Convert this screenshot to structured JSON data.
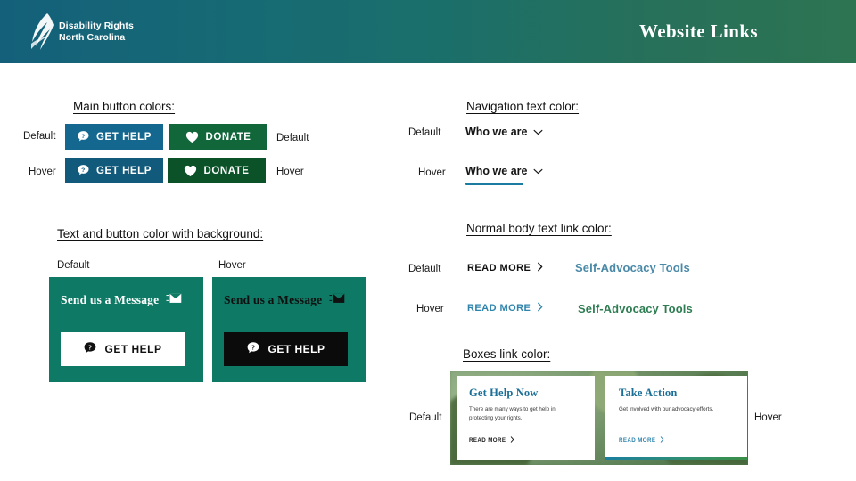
{
  "header": {
    "title": "Website Links",
    "logo_line1": "Disability Rights",
    "logo_line2": "North Carolina",
    "logo_icon": "feather-logo-icon",
    "gradient_from": "#14607a",
    "gradient_to": "#2d7452"
  },
  "sections": {
    "main_buttons": {
      "heading": "Main button colors:"
    },
    "bg_panels": {
      "heading": "Text and button color with background:"
    },
    "navigation": {
      "heading": "Navigation text color:"
    },
    "body_links": {
      "heading": "Normal body text link color:"
    },
    "boxes": {
      "heading": "Boxes link color:"
    }
  },
  "labels": {
    "default": "Default",
    "hover": "Hover"
  },
  "main_buttons": {
    "get_help": {
      "label": "GET HELP",
      "icon": "question-bubble-icon",
      "default_bg": "#14688f",
      "hover_bg": "#115a7c",
      "text_color": "#ffffff"
    },
    "donate": {
      "label": "DONATE",
      "icon": "heart-icon",
      "default_bg": "#11663a",
      "hover_bg": "#0c5229",
      "text_color": "#ffffff"
    }
  },
  "bg_panels": {
    "default": {
      "state_label": "Default",
      "panel_bg": "#0e7a65",
      "message_text": "Send us a Message",
      "message_color": "#ffffff",
      "message_icon": "envelope-icon",
      "button_label": "GET HELP",
      "button_icon": "question-bubble-icon",
      "button_bg": "#ffffff",
      "button_text_color": "#111111"
    },
    "hover": {
      "state_label": "Hover",
      "panel_bg": "#0e7a65",
      "message_text": "Send us a Message",
      "message_color": "#101010",
      "message_icon": "envelope-icon",
      "button_label": "GET HELP",
      "button_icon": "question-bubble-icon",
      "button_bg": "#0b0b0b",
      "button_text_color": "#ffffff"
    }
  },
  "navigation": {
    "default": {
      "state_label": "Default",
      "text": "Who we are",
      "icon": "chevron-down-icon",
      "color": "#151515"
    },
    "hover": {
      "state_label": "Hover",
      "text": "Who we are",
      "icon": "chevron-down-icon",
      "color": "#151515",
      "underline_color": "#1b7ba0"
    }
  },
  "body_links": {
    "default": {
      "state_label": "Default",
      "read_more": "READ MORE",
      "read_more_icon": "chevron-right-icon",
      "read_more_color": "#111111",
      "text_link": "Self-Advocacy Tools",
      "text_link_color": "#4a89a8"
    },
    "hover": {
      "state_label": "Hover",
      "read_more": "READ MORE",
      "read_more_icon": "chevron-right-icon",
      "read_more_color": "#2f84ad",
      "text_link": "Self-Advocacy Tools",
      "text_link_color": "#2e7d52"
    }
  },
  "boxes": {
    "default_label": "Default",
    "hover_label": "Hover",
    "cards": [
      {
        "title": "Get Help Now",
        "title_color": "#1b6f96",
        "body": "There are many ways to get help in protecting your rights.",
        "link": "READ MORE",
        "link_icon": "chevron-right-icon",
        "link_color": "#1a1a1a",
        "accent": false
      },
      {
        "title": "Take Action",
        "title_color": "#1b6f96",
        "body": "Get involved with our advocacy efforts.",
        "link": "READ MORE",
        "link_icon": "chevron-right-icon",
        "link_color": "#2f84ad",
        "accent": true,
        "accent_gradient_from": "#1b7fa0",
        "accent_gradient_to": "#3c8f46"
      }
    ]
  }
}
